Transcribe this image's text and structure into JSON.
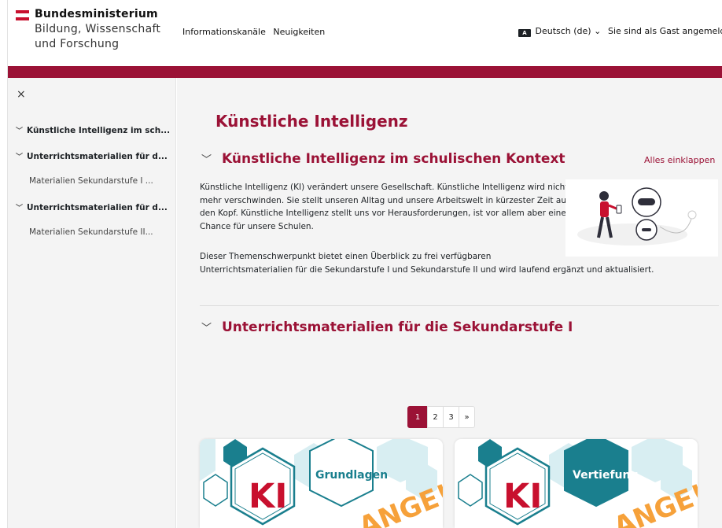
{
  "header": {
    "logo_line1": "Bundesministerium",
    "logo_line2": "Bildung, Wissenschaft",
    "logo_line3": "und Forschung",
    "nav": [
      "Informationskanäle",
      "Neuigkeiten"
    ],
    "language": "Deutsch (de)",
    "language_icon_text": "A",
    "guest_text": "Sie sind als Gast angemeldet"
  },
  "drawer": {
    "close_glyph": "×",
    "items": [
      {
        "label": "Künstliche Intelligenz im sch...",
        "level": 0
      },
      {
        "label": "Unterrichtsmaterialien für d...",
        "level": 0
      },
      {
        "label": "Materialien Sekundarstufe I ...",
        "level": 1
      },
      {
        "label": "Unterrichtsmaterialien für d...",
        "level": 0
      },
      {
        "label": "Materialien Sekundarstufe II...",
        "level": 1
      }
    ]
  },
  "main": {
    "page_title": "Künstliche Intelligenz",
    "section1_title": "Künstliche Intelligenz im schulischen Kontext",
    "collapse_all": "Alles einklappen",
    "para1_lines": [
      "Künstliche Intelligenz (KI) verändert unsere Gesellschaft. Künstliche Intelligenz wird nicht",
      "mehr verschwinden. Sie stellt unseren Alltag und unsere Arbeitswelt in kürzester Zeit auf",
      "den Kopf. Künstliche Intelligenz stellt uns vor Herausforderungen, ist vor allem aber eine",
      "Chance für unsere Schulen."
    ],
    "para2_lines": [
      "Dieser Themenschwerpunkt bietet einen Überblick zu frei verfügbaren",
      "Unterrichtsmaterialien für die Sekundarstufe I und Sekundarstufe II und wird laufend ergänzt und aktualisiert."
    ],
    "section2_title": "Unterrichtsmaterialien für die Sekundarstufe I",
    "pagination": [
      "1",
      "2",
      "3",
      "»"
    ],
    "cards": [
      {
        "ki": "KI",
        "word": "Grundlagen"
      },
      {
        "ki": "KI",
        "word": "Vertiefung"
      }
    ]
  },
  "colors": {
    "brand_red": "#9b1236",
    "flag_red": "#c8102e",
    "card_teal": "#1a7f8e"
  }
}
